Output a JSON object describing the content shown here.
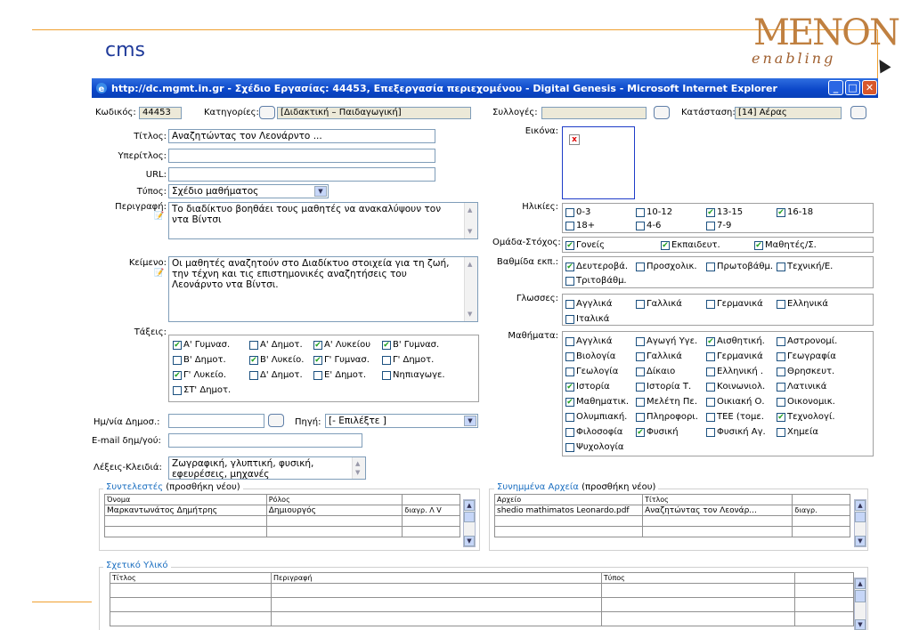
{
  "slide": {
    "title": "cms"
  },
  "logo": {
    "main": "MENON",
    "sub": "enabling"
  },
  "window": {
    "title": "http://dc.mgmt.in.gr - Σχέδιο Εργασίας: 44453, Επεξεργασία περιεχομένου - Digital Genesis - Microsoft Internet Explorer",
    "min_glyph": "_",
    "max_glyph": "□",
    "close_glyph": "✕"
  },
  "form": {
    "code_label": "Κωδικός:",
    "code_value": "44453",
    "categories_label": "Κατηγορίες:",
    "categories_value": "[Διδακτική – Παιδαγωγική]",
    "collections_label": "Συλλογές:",
    "collections_value": "",
    "status_label": "Κατάσταση:",
    "status_value": "[14] Αέρας",
    "title_label": "Τίτλος:",
    "title_value": "Αναζητώντας τον Λεονάρντο ...",
    "subtitle_label": "Υπερίτλος:",
    "subtitle_value": "",
    "url_label": "URL:",
    "url_value": "",
    "type_label": "Τύπος:",
    "type_value": "Σχέδιο μαθήματος",
    "description_label": "Περιγραφή:",
    "description_value": "Το διαδίκτυο βοηθάει τους μαθητές να ανακαλύψουν τον ντα Βίντσι",
    "text_label": "Κείμενο:",
    "text_value": "Οι μαθητές αναζητούν στο Διαδίκτυο στοιχεία για τη ζωή, την τέχνη και τις επιστημονικές αναζητήσεις του Λεονάρντο ντα Βίντσι.",
    "classes_label": "Τάξεις:",
    "classes": [
      {
        "label": "Α' Γυμνασ.",
        "checked": true
      },
      {
        "label": "Α' Δημοτ.",
        "checked": false
      },
      {
        "label": "Α' Λυκείου",
        "checked": true
      },
      {
        "label": "Β' Γυμνασ.",
        "checked": true
      },
      {
        "label": "Β' Δημοτ.",
        "checked": false
      },
      {
        "label": "Β' Λυκείο.",
        "checked": true
      },
      {
        "label": "Γ' Γυμνασ.",
        "checked": true
      },
      {
        "label": "Γ' Δημοτ.",
        "checked": false
      },
      {
        "label": "Γ' Λυκείο.",
        "checked": true
      },
      {
        "label": "Δ' Δημοτ.",
        "checked": false
      },
      {
        "label": "Ε' Δημοτ.",
        "checked": false
      },
      {
        "label": "Νηπιαγωγε.",
        "checked": false
      },
      {
        "label": "ΣΤ' Δημοτ.",
        "checked": false
      }
    ],
    "pubdate_label": "Ημ/νία Δημοσ.:",
    "pubdate_value": "",
    "source_label": "Πηγή:",
    "source_value": "[- Επιλέξτε ]",
    "email_label": "E-mail δημ/γού:",
    "email_value": "",
    "keywords_label": "Λέξεις-Κλειδιά:",
    "keywords_value": "Ζωγραφική, γλυπτική, φυσική, εφευρέσεις, μηχανές",
    "image_label": "Εικόνα:",
    "image_broken_glyph": "x",
    "ages_label": "Ηλικίες:",
    "ages": [
      {
        "label": "0-3",
        "checked": false
      },
      {
        "label": "10-12",
        "checked": false
      },
      {
        "label": "13-15",
        "checked": true
      },
      {
        "label": "16-18",
        "checked": true
      },
      {
        "label": "18+",
        "checked": false
      },
      {
        "label": "4-6",
        "checked": false
      },
      {
        "label": "7-9",
        "checked": false
      }
    ],
    "target_label": "Ομάδα-Στόχος:",
    "target": [
      {
        "label": "Γονείς",
        "checked": true
      },
      {
        "label": "Εκπαιδευτ.",
        "checked": true
      },
      {
        "label": "Μαθητές/Σ.",
        "checked": true
      }
    ],
    "level_label": "Βαθμίδα εκπ.:",
    "levels": [
      {
        "label": "Δευτεροβά.",
        "checked": true
      },
      {
        "label": "Προσχολικ.",
        "checked": false
      },
      {
        "label": "Πρωτοβάθμ.",
        "checked": false
      },
      {
        "label": "Τεχνική/Ε.",
        "checked": false
      },
      {
        "label": "Τριτοβάθμ.",
        "checked": false
      }
    ],
    "languages_label": "Γλωσσες:",
    "languages": [
      {
        "label": "Αγγλικά",
        "checked": false
      },
      {
        "label": "Γαλλικά",
        "checked": false
      },
      {
        "label": "Γερμανικά",
        "checked": false
      },
      {
        "label": "Ελληνικά",
        "checked": false
      },
      {
        "label": "Ιταλικά",
        "checked": false
      }
    ],
    "subjects_label": "Μαθήματα:",
    "subjects": [
      {
        "label": "Αγγλικά",
        "checked": false
      },
      {
        "label": "Αγωγή Υγε.",
        "checked": false
      },
      {
        "label": "Αισθητική.",
        "checked": true
      },
      {
        "label": "Αστρονομί.",
        "checked": false
      },
      {
        "label": "Βιολογία",
        "checked": false
      },
      {
        "label": "Γαλλικά",
        "checked": false
      },
      {
        "label": "Γερμανικά",
        "checked": false
      },
      {
        "label": "Γεωγραφία",
        "checked": false
      },
      {
        "label": "Γεωλογία",
        "checked": false
      },
      {
        "label": "Δίκαιο",
        "checked": false
      },
      {
        "label": "Ελληνική .",
        "checked": false
      },
      {
        "label": "Θρησκευτ.",
        "checked": false
      },
      {
        "label": "Ιστορία",
        "checked": true
      },
      {
        "label": "Ιστορία Τ.",
        "checked": false
      },
      {
        "label": "Κοινωνιολ.",
        "checked": false
      },
      {
        "label": "Λατινικά",
        "checked": false
      },
      {
        "label": "Μαθηματικ.",
        "checked": true
      },
      {
        "label": "Μελέτη Πε.",
        "checked": false
      },
      {
        "label": "Οικιακή Ο.",
        "checked": false
      },
      {
        "label": "Οικονομικ.",
        "checked": false
      },
      {
        "label": "Ολυμπιακή.",
        "checked": false
      },
      {
        "label": "Πληροφορι.",
        "checked": false
      },
      {
        "label": "ΤΕΕ (τομε.",
        "checked": false
      },
      {
        "label": "Τεχνολογί.",
        "checked": true
      },
      {
        "label": "Φιλοσοφία",
        "checked": false
      },
      {
        "label": "Φυσική",
        "checked": true
      },
      {
        "label": "Φυσική Αγ.",
        "checked": false
      },
      {
        "label": "Χημεία",
        "checked": false
      },
      {
        "label": "Ψυχολογία",
        "checked": false
      }
    ]
  },
  "contributors": {
    "legend_link": "Συντελεστές",
    "legend_text": "(προσθήκη νέου)",
    "col_name": "Όνομα",
    "col_role": "Ρόλος",
    "row_name": "Μαρκαντωνάτος Δημήτρης",
    "row_role": "Δημιουργός",
    "row_actions": "διαγρ. Λ V"
  },
  "attachments": {
    "legend_link": "Συνημμένα Αρχεία",
    "legend_text": "(προσθήκη νέου)",
    "col_file": "Αρχείο",
    "col_title": "Τίτλος",
    "row_file": "shedio mathimatos Leonardo.pdf",
    "row_title": "Αναζητώντας τον Λεονάρ...",
    "row_action": "διαγρ."
  },
  "related": {
    "legend_link": "Σχετικό Υλικό",
    "col_title": "Τίτλος",
    "col_desc": "Περιγραφή",
    "col_type": "Τύπος"
  },
  "colors": {
    "accent": "#f0a030",
    "title_blue": "#1f3a9a",
    "link": "#1a6ec0",
    "xp_blue": "#0a46c8"
  }
}
